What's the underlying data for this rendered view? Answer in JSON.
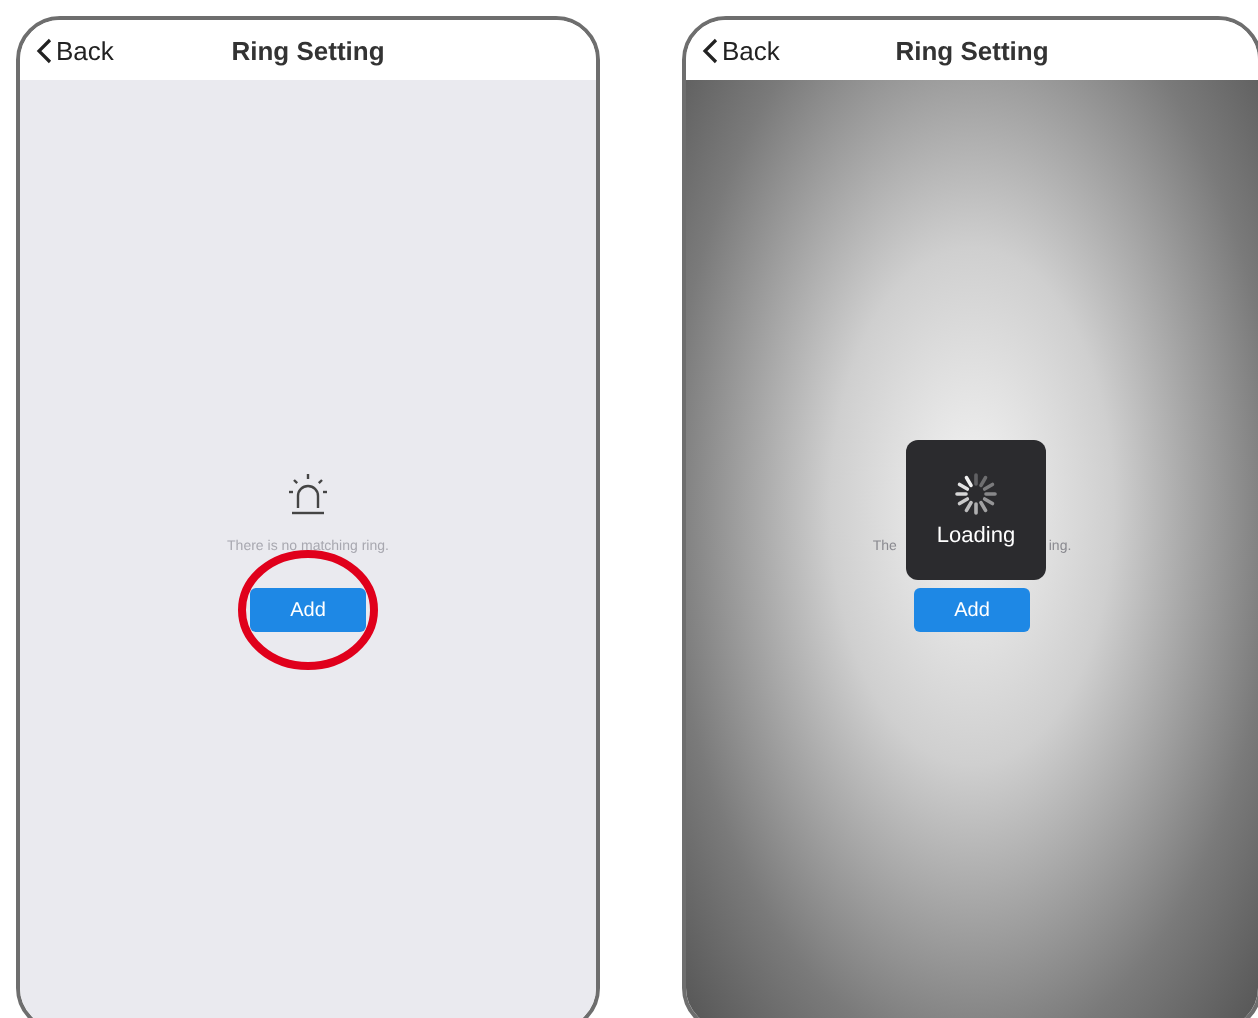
{
  "screens": [
    {
      "kind": "empty",
      "back": "Back",
      "title": "Ring Setting",
      "message_parts": [
        "There is no matching ring."
      ],
      "add_button": "Add",
      "highlighted": true
    },
    {
      "kind": "loading",
      "back": "Back",
      "title": "Ring Setting",
      "message_parts": [
        "The",
        "ing."
      ],
      "add_button": "Add",
      "highlighted": false,
      "loading_label": "Loading"
    }
  ]
}
